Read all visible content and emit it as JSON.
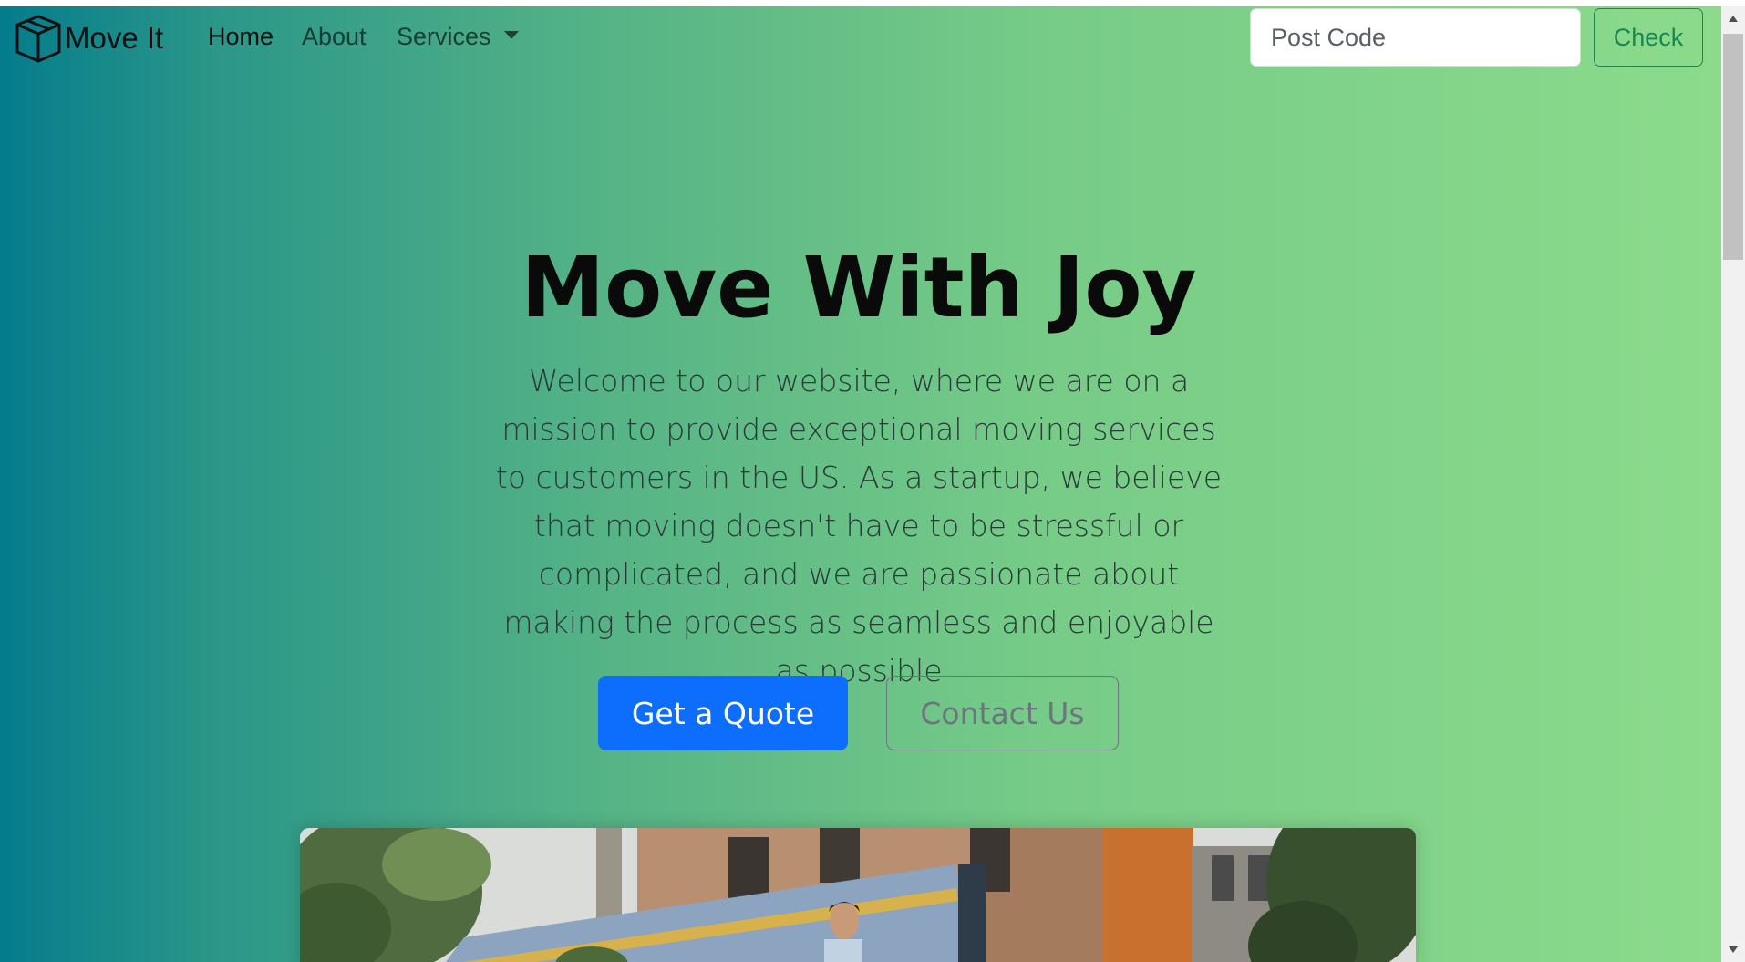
{
  "navbar": {
    "brand": "Move It",
    "brand_icon": "box-icon",
    "links": {
      "home": "Home",
      "about": "About",
      "services": "Services"
    },
    "search": {
      "placeholder": "Post Code",
      "value": ""
    },
    "check_label": "Check"
  },
  "hero": {
    "title": "Move With Joy",
    "lead": "Welcome to our website, where we are on a mission to provide exceptional moving services to customers in the US. As a startup, we believe that moving doesn't have to be stressful or complicated, and we are passionate about making the process as seamless and enjoyable as possible",
    "primary_button": "Get a Quote",
    "secondary_button": "Contact Us"
  },
  "colors": {
    "gradient_start": "#047c8c",
    "gradient_end": "#8cdb8c",
    "primary": "#0d6efd",
    "success": "#198754",
    "secondary": "#6c757d"
  }
}
